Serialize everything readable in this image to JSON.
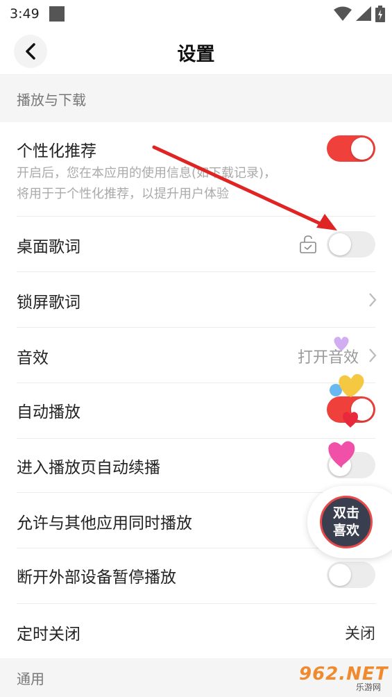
{
  "status_bar": {
    "time": "3:49"
  },
  "header": {
    "title": "设置"
  },
  "sections": {
    "playback_download": "播放与下载",
    "general": "通用"
  },
  "rows": {
    "personalized": {
      "label": "个性化推荐",
      "desc_line1": "开启后，您在本应用的使用信息(如下载记录)，",
      "desc_line2": "将用于于个性化推荐，以提升用户体验",
      "on": true
    },
    "desktop_lyrics": {
      "label": "桌面歌词",
      "on": false
    },
    "lockscreen_lyrics": {
      "label": "锁屏歌词"
    },
    "sound_effect": {
      "label": "音效",
      "value": "打开音效"
    },
    "autoplay": {
      "label": "自动播放",
      "on": true
    },
    "auto_continue": {
      "label": "进入播放页自动续播",
      "on": false
    },
    "allow_simultaneous": {
      "label": "允许与其他应用同时播放"
    },
    "pause_on_disconnect": {
      "label": "断开外部设备暂停播放",
      "on": false
    },
    "sleep_timer": {
      "label": "定时关闭",
      "value": "关闭"
    }
  },
  "floating": {
    "line1": "双击",
    "line2": "喜欢"
  },
  "watermark": {
    "text": "962.NET",
    "sub": "乐游网"
  },
  "colors": {
    "accent": "#f0403c",
    "arrow": "#e02424"
  }
}
